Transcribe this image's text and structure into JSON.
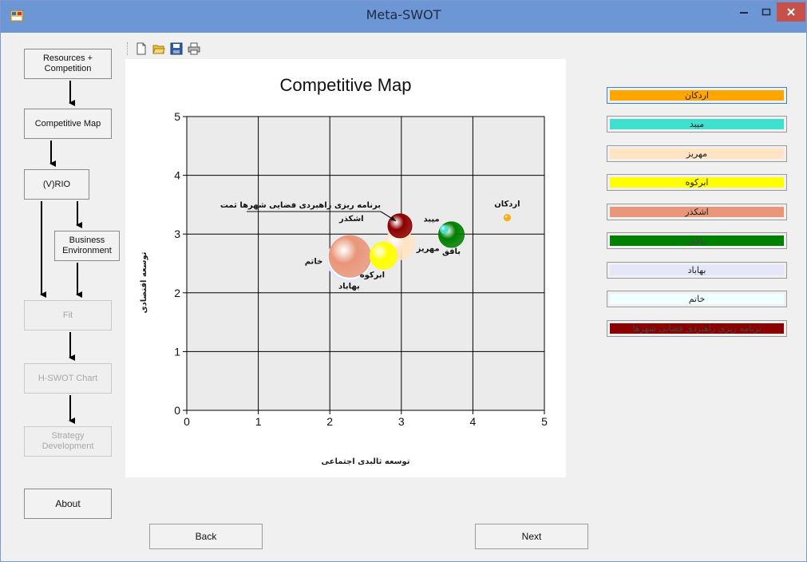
{
  "window": {
    "title": "Meta-SWOT"
  },
  "toolbar": {
    "icons": [
      "new-file-icon",
      "open-folder-icon",
      "save-icon",
      "print-icon"
    ]
  },
  "sidebar": {
    "resources": "Resources +\nCompetition",
    "competitive_map": "Competitive Map",
    "vrio": "(V)RIO",
    "business_env": "Business\nEnvironment",
    "fit": "Fit",
    "hswot": "H-SWOT Chart",
    "strategy": "Strategy\nDevelopment",
    "about": "About"
  },
  "footer": {
    "back": "Back",
    "next": "Next"
  },
  "legend": [
    {
      "label": "اردکان",
      "color": "#ffa500"
    },
    {
      "label": "میبد",
      "color": "#40e0d0"
    },
    {
      "label": "مهریز",
      "color": "#ffe4c4"
    },
    {
      "label": "ابرکوه",
      "color": "#ffff00"
    },
    {
      "label": "اشکذر",
      "color": "#e9967a"
    },
    {
      "label": "بافق",
      "color": "#008000"
    },
    {
      "label": "بهاباد",
      "color": "#e6e6fa"
    },
    {
      "label": "خاتم",
      "color": "#f0ffff"
    },
    {
      "label": "برنامه ریزی راهبردی فضایی شهرها",
      "color": "#8b0000"
    }
  ],
  "chart_data": {
    "type": "scatter",
    "title": "Competitive Map",
    "xlabel": "توسعه ثالبدی اجتماعی",
    "ylabel": "توسعه اقتصادی",
    "xlim": [
      0,
      5
    ],
    "ylim": [
      0,
      5
    ],
    "xticks": [
      "0",
      "1",
      "2",
      "3",
      "4",
      "5"
    ],
    "yticks": [
      "0",
      "1",
      "2",
      "3",
      "4",
      "5"
    ],
    "grid": true,
    "annotation": "برنامه ریزی راهبردی فضایی شهرها ثمت",
    "points": [
      {
        "name": "اردکان",
        "x": 4.48,
        "y": 3.28,
        "size": 4,
        "color": "#ffa500"
      },
      {
        "name": "میبد",
        "x": 3.6,
        "y": 3.08,
        "size": 5,
        "color": "#40e0d0"
      },
      {
        "name": "مهریز",
        "x": 2.97,
        "y": 2.82,
        "size": 19,
        "color": "#ffe4c4"
      },
      {
        "name": "ابرکوه",
        "x": 2.75,
        "y": 2.63,
        "size": 17,
        "color": "#ffff00"
      },
      {
        "name": "اشکذر",
        "x": 2.28,
        "y": 2.62,
        "size": 26,
        "color": "#e9967a"
      },
      {
        "name": "بافق",
        "x": 3.7,
        "y": 2.99,
        "size": 16,
        "color": "#008000"
      },
      {
        "name": "بهاباد",
        "x": 2.27,
        "y": 2.55,
        "size": 27,
        "color": "#e6e6fa"
      },
      {
        "name": "خاتم",
        "x": 2.28,
        "y": 2.6,
        "size": 27,
        "color": "#f0ffff"
      },
      {
        "name": "برنامه ریزی راهبردی فضایی شهرها",
        "x": 2.98,
        "y": 3.14,
        "size": 15,
        "color": "#8b0000"
      }
    ]
  }
}
